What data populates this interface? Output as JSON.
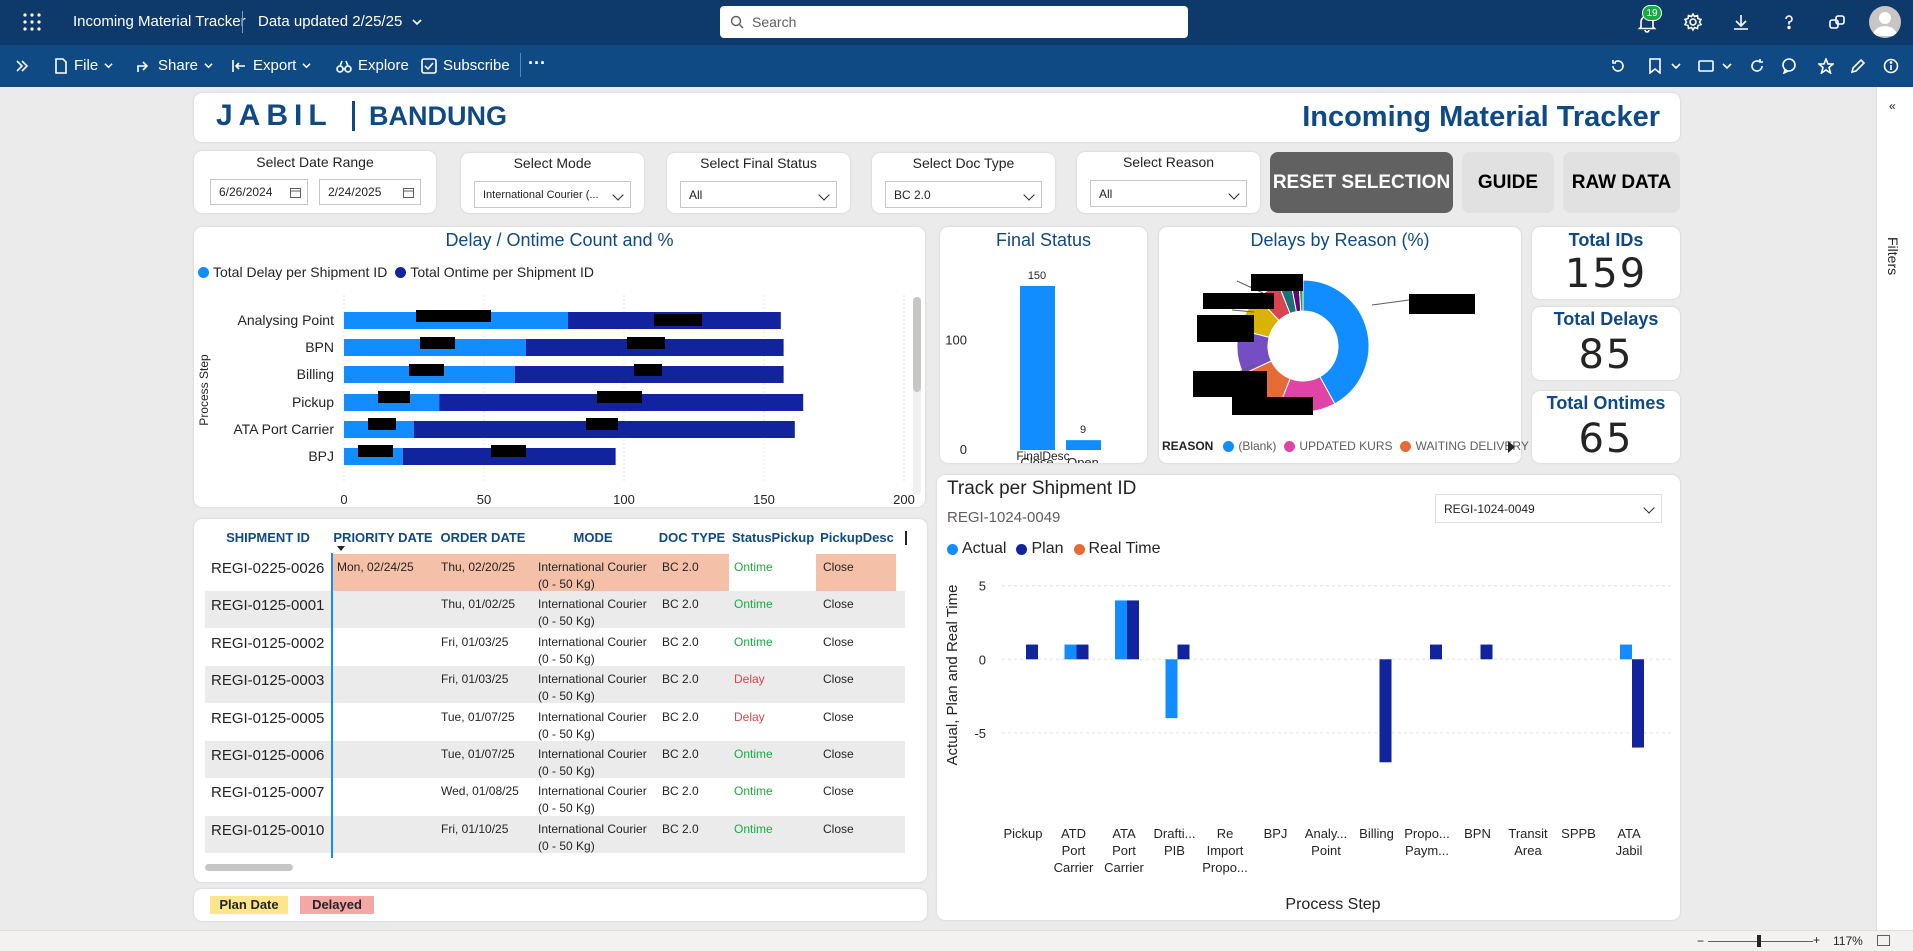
{
  "topbar": {
    "report_title": "Incoming Material Tracker",
    "data_updated": "Data updated 2/25/25",
    "search_placeholder": "Search",
    "notification_count": "19"
  },
  "cmdbar": {
    "file": "File",
    "share": "Share",
    "export": "Export",
    "explore": "Explore",
    "subscribe": "Subscribe"
  },
  "header": {
    "logo_text": "JABIL",
    "location": "BANDUNG",
    "title": "Incoming Material Tracker"
  },
  "slicers": {
    "date_range": {
      "title": "Select Date Range",
      "start": "6/26/2024",
      "end": "2/24/2025"
    },
    "mode": {
      "title": "Select Mode",
      "value": "International Courier (..."
    },
    "final_status": {
      "title": "Select Final Status",
      "value": "All"
    },
    "doc_type": {
      "title": "Select Doc Type",
      "value": "BC 2.0"
    },
    "reason": {
      "title": "Select Reason",
      "value": "All"
    }
  },
  "buttons": {
    "reset": "RESET SELECTION",
    "guide": "GUIDE",
    "raw": "RAW DATA"
  },
  "kpis": {
    "total_ids": {
      "label": "Total IDs",
      "value": "159"
    },
    "total_delays": {
      "label": "Total Delays",
      "value": "85"
    },
    "total_ontimes": {
      "label": "Total Ontimes",
      "value": "65"
    }
  },
  "colors": {
    "delay": "#118dff",
    "ontime": "#12239e",
    "realtime": "#e66c37",
    "accent": "#0f4a85",
    "highlight_row": "#f4c0a8"
  },
  "delay_chart_meta": {
    "title": "Delay / Ontime Count and %",
    "legend_delay": "Total Delay per Shipment ID",
    "legend_ontime": "Total Ontime per Shipment ID",
    "ylabel": "Process Step"
  },
  "final_status_meta": {
    "title": "Final Status",
    "xlabel": "FinalDesc"
  },
  "reason_meta": {
    "title": "Delays by Reason (%)",
    "legend_title": "REASON",
    "legend_items": [
      "(Blank)",
      "UPDATED KURS",
      "WAITING DELIVERY"
    ]
  },
  "track_meta": {
    "title": "Track per Shipment ID",
    "subtitle": "REGI-1024-0049",
    "select_value": "REGI-1024-0049",
    "legend": [
      "Actual",
      "Plan",
      "Real Time"
    ],
    "ylabel": "Actual, Plan and Real Time",
    "xlabel": "Process Step"
  },
  "table": {
    "headers": [
      "SHIPMENT ID",
      "PRIORITY DATE",
      "ORDER DATE",
      "MODE",
      "DOC TYPE",
      "StatusPickup",
      "PickupDesc"
    ],
    "rows": [
      {
        "id": "REGI-0225-0026",
        "priority": "Mon, 02/24/25",
        "order": "Thu, 02/20/25",
        "mode1": "International Courier",
        "mode2": "(0 - 50 Kg)",
        "doc": "BC 2.0",
        "status": "Ontime",
        "desc": "Close"
      },
      {
        "id": "REGI-0125-0001",
        "priority": "",
        "order": "Thu, 01/02/25",
        "mode1": "International Courier",
        "mode2": "(0 - 50 Kg)",
        "doc": "BC 2.0",
        "status": "Ontime",
        "desc": "Close"
      },
      {
        "id": "REGI-0125-0002",
        "priority": "",
        "order": "Fri, 01/03/25",
        "mode1": "International Courier",
        "mode2": "(0 - 50 Kg)",
        "doc": "BC 2.0",
        "status": "Ontime",
        "desc": "Close"
      },
      {
        "id": "REGI-0125-0003",
        "priority": "",
        "order": "Fri, 01/03/25",
        "mode1": "International Courier",
        "mode2": "(0 - 50 Kg)",
        "doc": "BC 2.0",
        "status": "Delay",
        "desc": "Close"
      },
      {
        "id": "REGI-0125-0005",
        "priority": "",
        "order": "Tue, 01/07/25",
        "mode1": "International Courier",
        "mode2": "(0 - 50 Kg)",
        "doc": "BC 2.0",
        "status": "Delay",
        "desc": "Close"
      },
      {
        "id": "REGI-0125-0006",
        "priority": "",
        "order": "Tue, 01/07/25",
        "mode1": "International Courier",
        "mode2": "(0 - 50 Kg)",
        "doc": "BC 2.0",
        "status": "Ontime",
        "desc": "Close"
      },
      {
        "id": "REGI-0125-0007",
        "priority": "",
        "order": "Wed, 01/08/25",
        "mode1": "International Courier",
        "mode2": "(0 - 50 Kg)",
        "doc": "BC 2.0",
        "status": "Ontime",
        "desc": "Close"
      },
      {
        "id": "REGI-0125-0010",
        "priority": "",
        "order": "Fri, 01/10/25",
        "mode1": "International Courier",
        "mode2": "(0 - 50 Kg)",
        "doc": "BC 2.0",
        "status": "Ontime",
        "desc": "Close"
      }
    ]
  },
  "footer_legend": {
    "plan_date": "Plan Date",
    "delayed": "Delayed"
  },
  "statusbar": {
    "zoom": "117%"
  },
  "filters_label": "Filters",
  "chart_data": [
    {
      "type": "bar",
      "orientation": "horizontal",
      "stacked": true,
      "title": "Delay / Ontime Count and %",
      "ylabel": "Process Step",
      "categories": [
        "Analysing Point",
        "BPN",
        "Billing",
        "Pickup",
        "ATA Port Carrier",
        "BPJ"
      ],
      "series": [
        {
          "name": "Total Delay per Shipment ID",
          "values": [
            80,
            65,
            61,
            34,
            25,
            21
          ]
        },
        {
          "name": "Total Ontime per Shipment ID",
          "values": [
            76,
            92,
            96,
            130,
            136,
            76
          ]
        }
      ],
      "xlim": [
        0,
        200
      ],
      "xticks": [
        0,
        50,
        100,
        150,
        200
      ],
      "legend_position": "top-left",
      "grid": true
    },
    {
      "type": "bar",
      "title": "Final Status",
      "xlabel": "FinalDesc",
      "categories": [
        "Close",
        "Open"
      ],
      "values": [
        150,
        9
      ],
      "ylim": [
        0,
        160
      ],
      "yticks": [
        0,
        100
      ]
    },
    {
      "type": "pie",
      "donut": true,
      "title": "Delays by Reason (%)",
      "legend_title": "REASON",
      "slices": [
        {
          "name": "(Blank)",
          "value": 42,
          "color": "#118dff"
        },
        {
          "name": "UPDATED KURS",
          "value": 14,
          "color": "#e044a7"
        },
        {
          "name": "WAITING DELIVERY",
          "value": 12,
          "color": "#e66c37"
        },
        {
          "value": 11,
          "color": "#744ec2"
        },
        {
          "value": 9,
          "color": "#d9b300"
        },
        {
          "value": 6,
          "color": "#d64550"
        },
        {
          "value": 3,
          "color": "#197278"
        },
        {
          "value": 2,
          "color": "#6b007b"
        },
        {
          "value": 1,
          "color": "#1aab40"
        }
      ]
    },
    {
      "type": "bar",
      "title": "Track per Shipment ID",
      "xlabel": "Process Step",
      "ylabel": "Actual, Plan and Real Time",
      "categories": [
        "Pickup",
        "ATD Port Carrier",
        "ATA Port Carrier",
        "Drafti... PIB",
        "Re Import Propo...",
        "BPJ",
        "Analy... Point",
        "Billing",
        "Propo... Paym...",
        "BPN",
        "Transit Area",
        "SPPB",
        "ATA Jabil"
      ],
      "series": [
        {
          "name": "Actual",
          "values": [
            0,
            1,
            4,
            -4,
            0,
            0,
            0,
            0,
            0,
            0,
            0,
            0,
            1
          ]
        },
        {
          "name": "Plan",
          "values": [
            1,
            1,
            4,
            1,
            0,
            0,
            0,
            -7,
            1,
            1,
            0,
            0,
            -6
          ]
        },
        {
          "name": "Real Time",
          "values": [
            0,
            0,
            0,
            0,
            0,
            0,
            0,
            0,
            0,
            0,
            0,
            0,
            0
          ]
        }
      ],
      "ylim": [
        -8,
        6
      ],
      "yticks": [
        -5,
        0,
        5
      ],
      "legend_position": "top-left"
    }
  ]
}
